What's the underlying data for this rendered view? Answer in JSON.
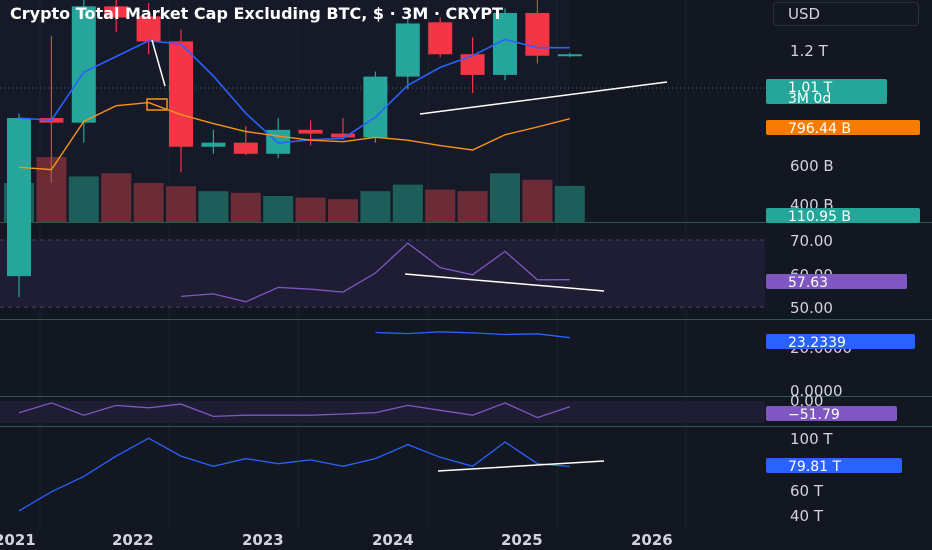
{
  "header": {
    "title": "Crypto Total Market Cap Excluding BTC, $ · 3M · CRYPT",
    "currency": "USD"
  },
  "colors": {
    "background": "#131722",
    "up": "#26a69a",
    "down": "#f23645",
    "ma_blue": "#2962ff",
    "ma_orange": "#f7931a",
    "rsi": "#7e57c2",
    "trendline": "#ffffff"
  },
  "price_axis": {
    "ticks": [
      "1.2 T",
      "600 B",
      "400 B"
    ]
  },
  "badges": {
    "last_price": "1.01 T",
    "countdown": "3M 0d",
    "ma_orange_value": "796.44 B",
    "volume_value": "110.95 B",
    "rsi_value": "57.63",
    "indicator2_value": "23.2339",
    "indicator3_value": "−51.79",
    "indicator4_value": "79.81 T"
  },
  "pane_axes": {
    "rsi_ticks": [
      "70.00",
      "60.00",
      "50.00"
    ],
    "indicator2_ticks": [
      "20.0000",
      "0.0000"
    ],
    "indicator3_ticks": [
      "0.00"
    ],
    "indicator4_ticks": [
      "100 T",
      "60 T",
      "40 T"
    ]
  },
  "time_axis": {
    "labels": [
      "2021",
      "2022",
      "2023",
      "2024",
      "2025",
      "2026"
    ]
  },
  "chart_data": [
    {
      "type": "candlestick",
      "title": "Crypto Total Market Cap Excluding BTC, $ · 3M · CRYPT",
      "y_unit": "USD",
      "y_scale": "log",
      "ylim": [
        330000000000,
        1450000000000
      ],
      "x": [
        "2021-Q1",
        "2021-Q2",
        "2021-Q3",
        "2021-Q4",
        "2022-Q1",
        "2022-Q2",
        "2022-Q3",
        "2022-Q4",
        "2023-Q1",
        "2023-Q2",
        "2023-Q3",
        "2023-Q4",
        "2024-Q1",
        "2024-Q2",
        "2024-Q3",
        "2024-Q4",
        "2025-Q1",
        "2025-Q2"
      ],
      "open": [
        230,
        660,
        640,
        1390,
        1300,
        1100,
        545,
        560,
        520,
        610,
        595,
        580,
        870,
        1250,
        1010,
        880,
        1330,
        1000
      ],
      "high": [
        680,
        1140,
        1450,
        1450,
        1420,
        1190,
        610,
        625,
        660,
        650,
        660,
        900,
        1280,
        1290,
        1130,
        1370,
        1450,
        1020
      ],
      "low": [
        200,
        430,
        560,
        1170,
        1010,
        460,
        520,
        515,
        505,
        550,
        570,
        560,
        800,
        990,
        780,
        850,
        950,
        990
      ],
      "close": [
        660,
        640,
        1390,
        1290,
        1100,
        545,
        560,
        520,
        610,
        595,
        580,
        870,
        1240,
        1010,
        880,
        1330,
        1000,
        1010
      ],
      "value_unit": "billions USD",
      "last_value": "1.01 T"
    },
    {
      "type": "bar",
      "title": "Volume",
      "values": [
        120,
        200,
        140,
        150,
        120,
        110,
        95,
        90,
        80,
        75,
        70,
        95,
        115,
        100,
        95,
        150,
        130,
        110.95
      ],
      "unit": "billions USD (approx.)",
      "last_value": "110.95 B"
    },
    {
      "type": "line",
      "title": "RSI",
      "ylim": [
        47,
        72
      ],
      "values": [
        null,
        null,
        null,
        null,
        null,
        53.0,
        53.7,
        51.5,
        55.5,
        55.0,
        54.2,
        59.5,
        67.8,
        61.0,
        59.0,
        65.5,
        57.6,
        57.63
      ],
      "last_value": "57.63"
    },
    {
      "type": "line",
      "title": "",
      "ylim": [
        -1,
        30
      ],
      "values": [
        null,
        null,
        null,
        null,
        null,
        null,
        null,
        null,
        null,
        null,
        null,
        25.5,
        25.0,
        25.8,
        25.3,
        24.6,
        24.9,
        23.2339
      ],
      "last_value": "23.2339"
    },
    {
      "type": "line",
      "title": "",
      "ylim": [
        -200,
        20
      ],
      "values": [
        -100,
        -20,
        -120,
        -40,
        -60,
        -30,
        -130,
        -120,
        -120,
        -120,
        -110,
        -100,
        -40,
        -80,
        -120,
        -20,
        -140,
        -51.79
      ],
      "last_value": "−51.79"
    },
    {
      "type": "line",
      "title": "",
      "unit": "T",
      "ylim": [
        30,
        110
      ],
      "values": [
        45,
        60,
        72,
        88,
        102,
        88,
        80,
        86,
        82,
        85,
        80,
        86,
        97,
        87,
        80,
        99,
        82,
        79.81
      ],
      "last_value": "79.81 T"
    }
  ]
}
